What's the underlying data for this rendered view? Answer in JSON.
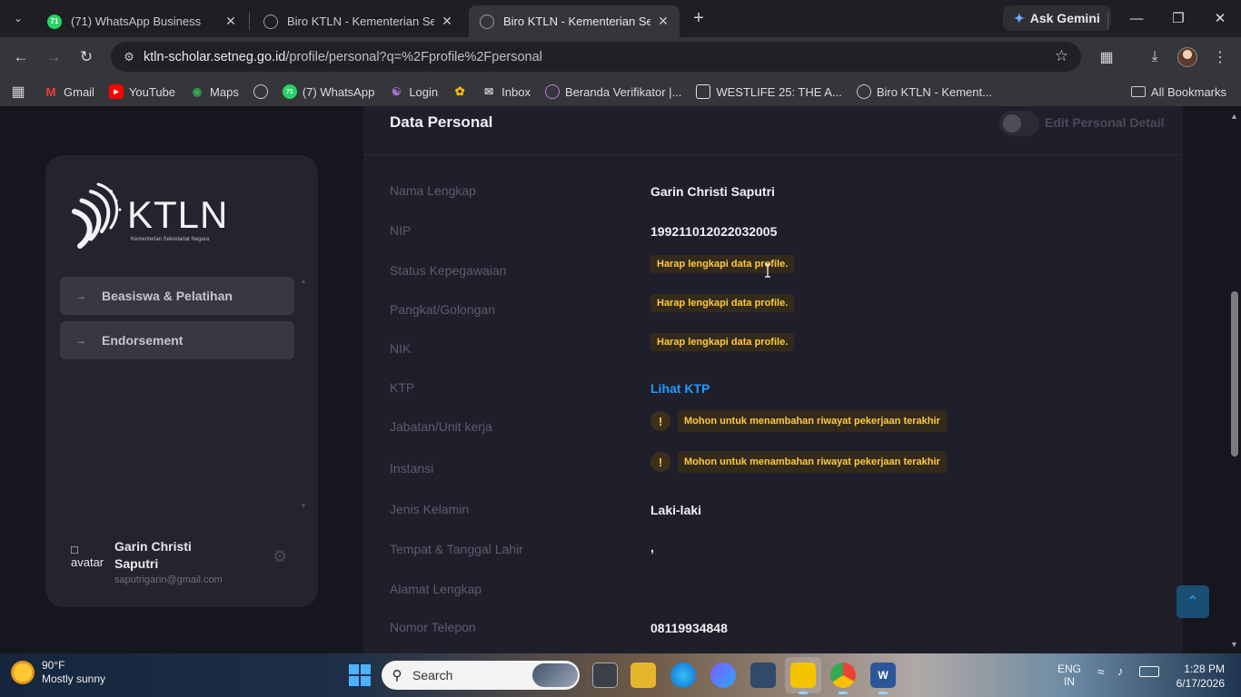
{
  "browser": {
    "tabs": [
      {
        "title": "(71) WhatsApp Business",
        "badge": "71"
      },
      {
        "title": "Biro KTLN - Kementerian Sekretariat Negara"
      },
      {
        "title": "Biro KTLN - Kementerian Sekretariat Negara"
      }
    ],
    "new_tab": "+",
    "gemini_label": "Ask Gemini",
    "url_host": "ktln-scholar.setneg.go.id",
    "url_path": "/profile/personal?q=%2Fprofile%2Fpersonal",
    "bookmarks": [
      {
        "label": "Gmail",
        "icon": "gmail-icon"
      },
      {
        "label": "YouTube",
        "icon": "youtube-icon"
      },
      {
        "label": "Maps",
        "icon": "maps-icon"
      },
      {
        "label": "",
        "icon": "globe-icon"
      },
      {
        "label": "(7) WhatsApp",
        "icon": "whatsapp-icon",
        "badge": "71"
      },
      {
        "label": "Login",
        "icon": "login-icon"
      },
      {
        "label": "",
        "icon": "pinwheel-icon"
      },
      {
        "label": "Inbox",
        "icon": "mail-icon"
      },
      {
        "label": "Beranda Verifikator |...",
        "icon": "globe-icon"
      },
      {
        "label": "WESTLIFE 25: THE A...",
        "icon": "bookmark-icon"
      },
      {
        "label": "Biro KTLN - Kement...",
        "icon": "globe-icon"
      }
    ],
    "all_bookmarks": "All Bookmarks"
  },
  "sidebar": {
    "logo_text": "KTLN",
    "logo_subtitle": "Kementerian Sekretariat Negara",
    "menu": [
      {
        "label": "Beasiswa & Pelatihan"
      },
      {
        "label": "Endorsement"
      }
    ],
    "user": {
      "avatar_alt": "avatar",
      "name": "Garin Christi Saputri",
      "email": "saputrigarin@gmail.com"
    }
  },
  "profile": {
    "title": "Data Personal",
    "edit_label": "Edit Personal Detail",
    "rows": [
      {
        "label": "Nama Lengkap",
        "value": "Garin Christi Saputri"
      },
      {
        "label": "NIP",
        "value": "199211012022032005"
      },
      {
        "label": "Status Kepegawaian",
        "warning": "Harap lengkapi data profile."
      },
      {
        "label": "Pangkat/Golongan",
        "warning": "Harap lengkapi data profile."
      },
      {
        "label": "NIK",
        "warning": "Harap lengkapi data profile."
      },
      {
        "label": "KTP",
        "link": "Lihat KTP"
      },
      {
        "label": "Jabatan/Unit kerja",
        "alert": "Mohon untuk menambahan riwayat pekerjaan terakhir"
      },
      {
        "label": "Instansi",
        "alert": "Mohon untuk menambahan riwayat pekerjaan terakhir"
      },
      {
        "label": "Jenis Kelamin",
        "value": "Laki-laki"
      },
      {
        "label": "Tempat & Tanggal Lahir",
        "value": ","
      },
      {
        "label": "Alamat Lengkap",
        "value": ""
      },
      {
        "label": "Nomor Telepon",
        "value": "08119934848"
      }
    ],
    "alert_icon": "!"
  },
  "taskbar": {
    "weather_temp": "90°F",
    "weather_desc": "Mostly sunny",
    "search_placeholder": "Search",
    "lang_top": "ENG",
    "lang_bottom": "IN",
    "time": "1:28 PM",
    "date": "6/17/2026"
  },
  "colors": {
    "accent_link": "#1e9bff",
    "warning_text": "#ffc940",
    "page_bg": "#16161f",
    "card_bg": "#1f1f2b"
  }
}
